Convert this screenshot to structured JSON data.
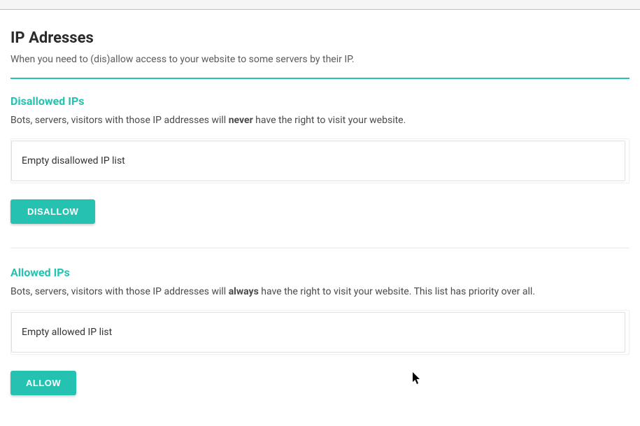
{
  "page": {
    "title": "IP Adresses",
    "subtitle": "When you need to (dis)allow access to your website to some servers by their IP."
  },
  "disallowed": {
    "title": "Disallowed IPs",
    "desc_prefix": "Bots, servers, visitors with those IP addresses will ",
    "emph": "never",
    "desc_suffix": " have the right to visit your website.",
    "list_empty_text": "Empty disallowed IP list",
    "button_label": "DISALLOW"
  },
  "allowed": {
    "title": "Allowed IPs",
    "desc_prefix": "Bots, servers, visitors with those IP addresses will ",
    "emph": "always",
    "desc_suffix": " have the right to visit your website. This list has priority over all.",
    "list_empty_text": "Empty allowed IP list",
    "button_label": "ALLOW"
  }
}
